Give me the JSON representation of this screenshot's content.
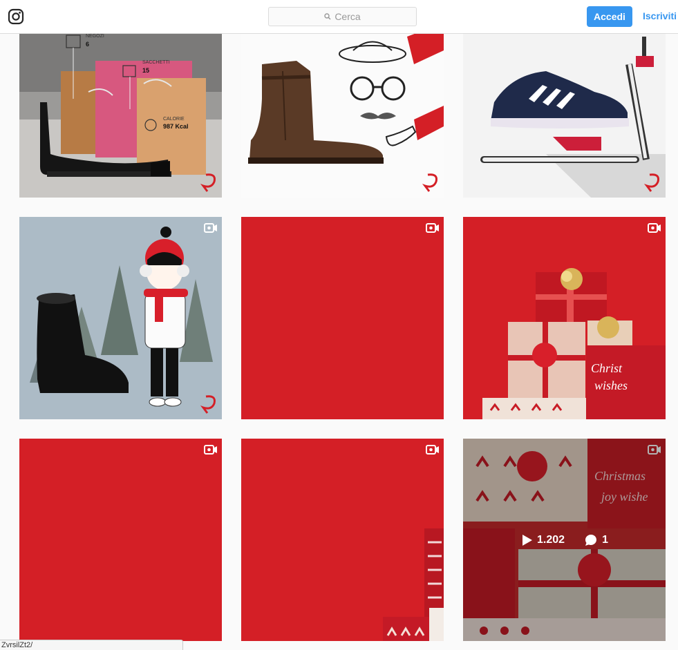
{
  "header": {
    "search_placeholder": "Cerca",
    "login_label": "Accedi",
    "signup_label": "Iscriviti"
  },
  "posts": [
    {
      "type": "photo",
      "labels": {
        "stores_label": "NEGOZI",
        "stores_value": "6",
        "bags_label": "SACCHETTI",
        "bags_value": "15",
        "cal_label": "CALORIE",
        "cal_value": "987 Kcal"
      }
    },
    {
      "type": "photo"
    },
    {
      "type": "photo"
    },
    {
      "type": "video"
    },
    {
      "type": "video"
    },
    {
      "type": "video"
    },
    {
      "type": "video"
    },
    {
      "type": "video"
    },
    {
      "type": "video",
      "hover": {
        "views": "1.202",
        "comments": "1"
      }
    }
  ],
  "status_bar": {
    "url_fragment": "ZvrsilZt2/"
  },
  "colors": {
    "accent": "#3897f0",
    "brand_red": "#d41f26"
  }
}
